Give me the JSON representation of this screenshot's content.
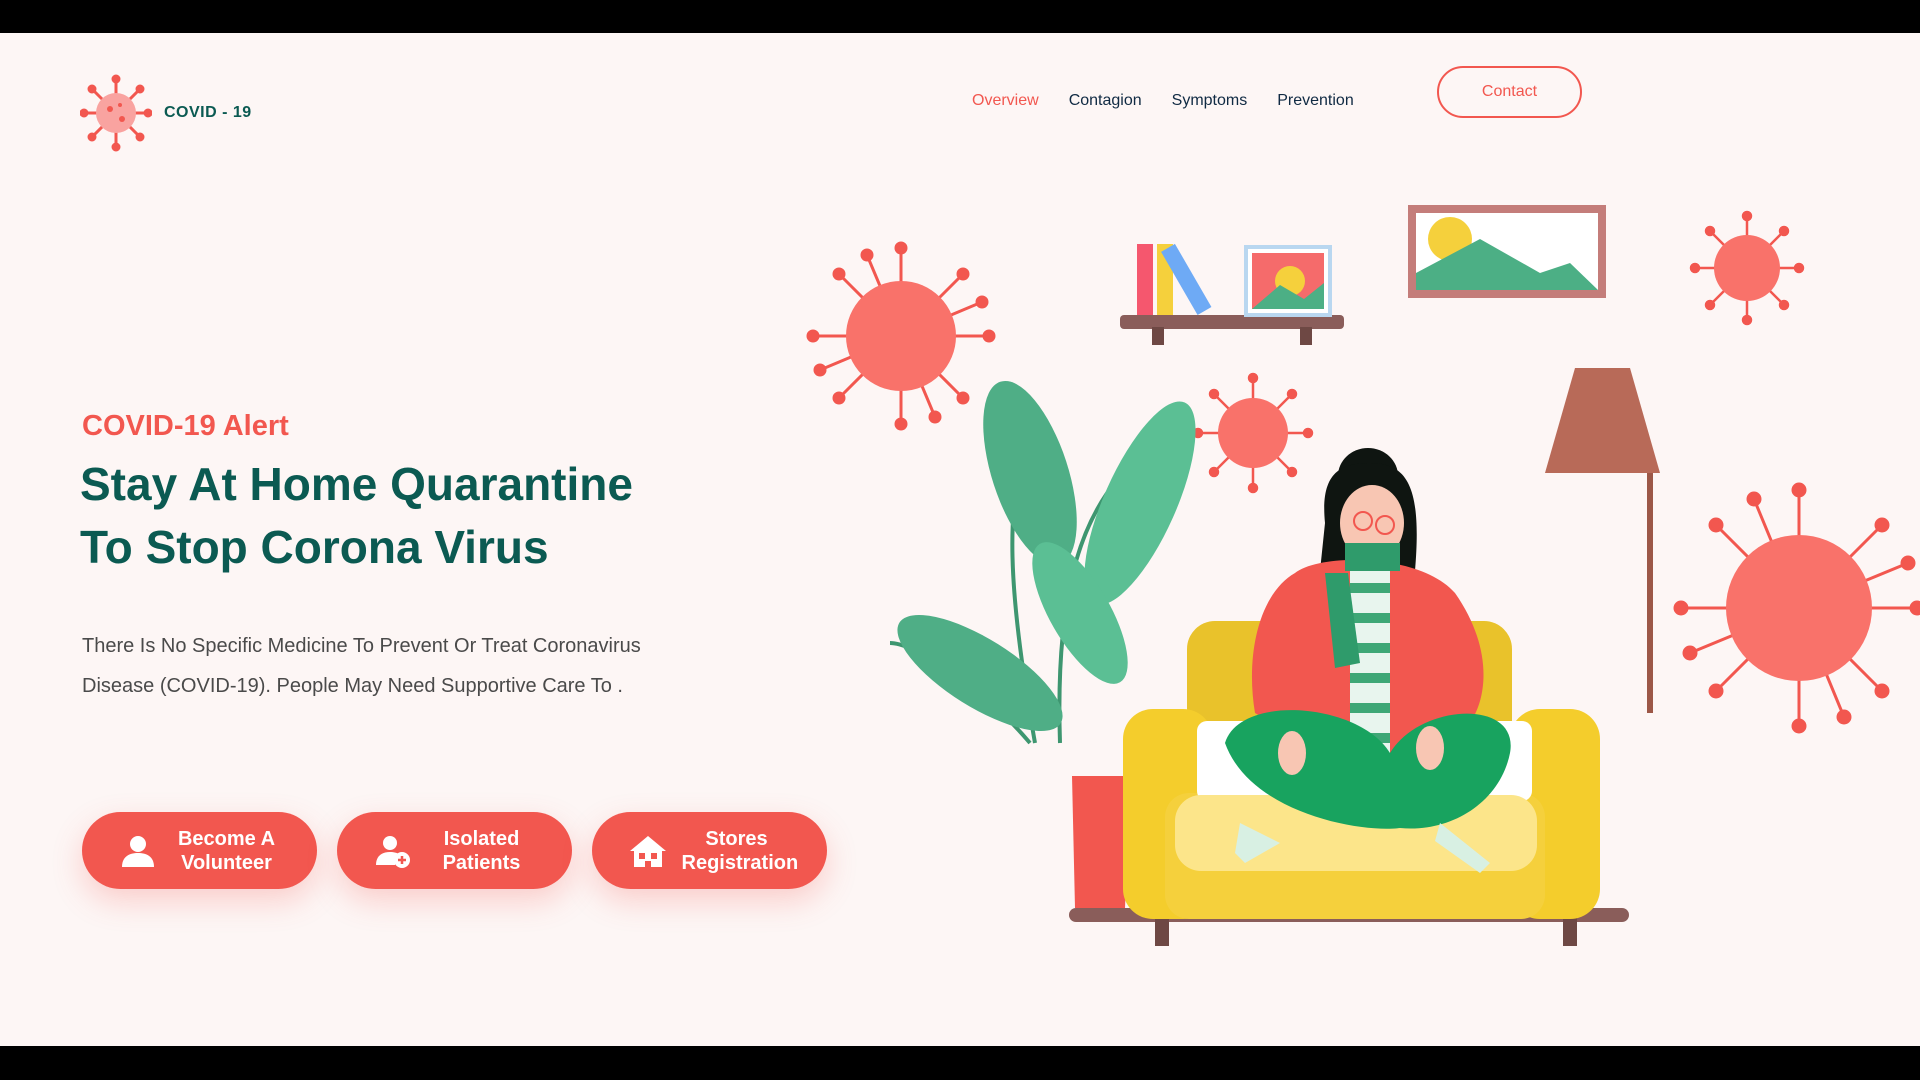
{
  "brand": {
    "name": "COVID - 19",
    "accent": "#f2574f",
    "primary": "#0b5a52"
  },
  "nav": {
    "items": [
      "Overview",
      "Contagion",
      "Symptoms",
      "Prevention"
    ],
    "active": "Overview",
    "contact_label": "Contact"
  },
  "hero": {
    "alert": "COVID-19 Alert",
    "title_line1": "Stay At Home Quarantine",
    "title_line2": "To Stop Corona Virus",
    "description_line1": "There Is No Specific Medicine To Prevent Or Treat Coronavirus",
    "description_line2": "Disease (COVID-19). People May Need Supportive Care To ."
  },
  "actions": [
    {
      "line1": "Become A",
      "line2": "Volunteer",
      "icon": "user-icon"
    },
    {
      "line1": "Isolated",
      "line2": "Patients",
      "icon": "user-plus-icon"
    },
    {
      "line1": "Stores",
      "line2": "Registration",
      "icon": "store-icon"
    }
  ],
  "illustration": {
    "description_icon": "woman-on-sofa-illustration"
  }
}
